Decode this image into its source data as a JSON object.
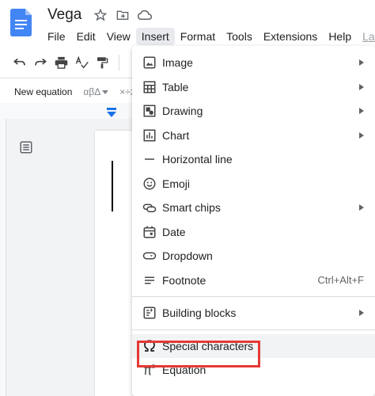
{
  "doc": {
    "title": "Vega"
  },
  "menubar": {
    "items": [
      {
        "label": "File"
      },
      {
        "label": "Edit"
      },
      {
        "label": "View"
      },
      {
        "label": "Insert"
      },
      {
        "label": "Format"
      },
      {
        "label": "Tools"
      },
      {
        "label": "Extensions"
      },
      {
        "label": "Help"
      },
      {
        "label": "Las"
      }
    ]
  },
  "equation_bar": {
    "new_equation": "New equation",
    "greek": "αβΔ",
    "operators": "×÷≥"
  },
  "insert_menu": {
    "items": [
      {
        "label": "Image",
        "icon": "image-icon",
        "submenu": true
      },
      {
        "label": "Table",
        "icon": "table-icon",
        "submenu": true
      },
      {
        "label": "Drawing",
        "icon": "drawing-icon",
        "submenu": true
      },
      {
        "label": "Chart",
        "icon": "chart-icon",
        "submenu": true
      },
      {
        "label": "Horizontal line",
        "icon": "horizontal-line-icon",
        "submenu": false
      },
      {
        "label": "Emoji",
        "icon": "emoji-icon",
        "submenu": false
      },
      {
        "label": "Smart chips",
        "icon": "smart-chips-icon",
        "submenu": true
      },
      {
        "label": "Date",
        "icon": "calendar-icon",
        "submenu": false
      },
      {
        "label": "Dropdown",
        "icon": "dropdown-icon",
        "submenu": false
      },
      {
        "label": "Footnote",
        "icon": "footnote-icon",
        "submenu": false,
        "shortcut": "Ctrl+Alt+F"
      },
      {
        "label": "Building blocks",
        "icon": "building-blocks-icon",
        "submenu": true
      },
      {
        "label": "Special characters",
        "icon": "omega-icon",
        "submenu": false
      },
      {
        "label": "Equation",
        "icon": "pi-icon",
        "submenu": false
      }
    ]
  },
  "colors": {
    "accent": "#1a73e8",
    "highlight_border": "#e53935"
  }
}
